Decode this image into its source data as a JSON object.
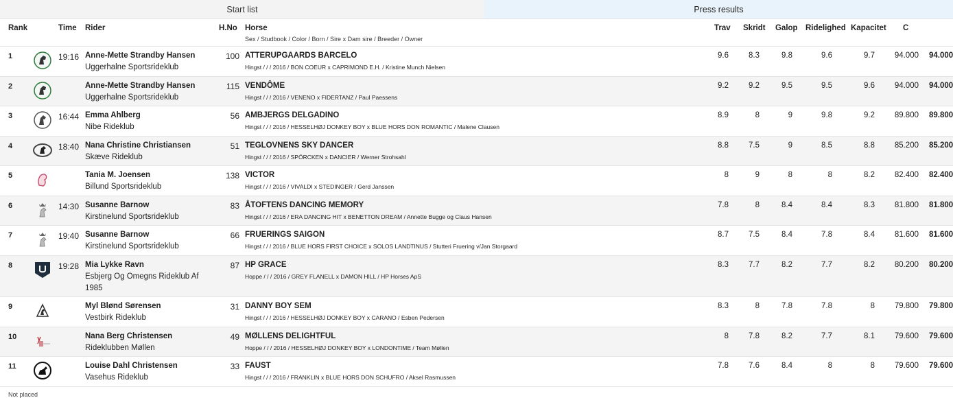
{
  "tabs": {
    "start_list": "Start list",
    "press_results": "Press results"
  },
  "headers": {
    "rank": "Rank",
    "time": "Time",
    "rider": "Rider",
    "hno": "H.No",
    "horse": "Horse",
    "horse_sub": "Sex / Studbook / Color / Born / Sire x Dam sire / Breeder / Owner",
    "trav": "Trav",
    "skridt": "Skridt",
    "galop": "Galop",
    "ridelighed": "Ridelighed",
    "kapacitet": "Kapacitet",
    "c": "C"
  },
  "rows": [
    {
      "rank": "1",
      "logo": "horse-head-logo",
      "time": "19:16",
      "rider": "Anne-Mette Strandby Hansen",
      "club": "Uggerhalne Sportsrideklub",
      "club2": "",
      "hno": "100",
      "horse": "ATTERUPGAARDS BARCELO",
      "info": "Hingst / / / 2016 / BON COEUR x CAPRIMOND E.H. / Kristine Munch Nielsen",
      "trav": "9.6",
      "skridt": "8.3",
      "galop": "9.8",
      "ridelighed": "9.6",
      "kapacitet": "9.7",
      "c": "94.000",
      "total": "94.000"
    },
    {
      "rank": "2",
      "logo": "horse-head-logo",
      "time": "",
      "rider": "Anne-Mette Strandby Hansen",
      "club": "Uggerhalne Sportsrideklub",
      "club2": "",
      "hno": "115",
      "horse": "VENDÔME",
      "info": "Hingst / / / 2016 / VENENO x FIDERTANZ / Paul Paessens",
      "trav": "9.2",
      "skridt": "9.2",
      "galop": "9.5",
      "ridelighed": "9.5",
      "kapacitet": "9.6",
      "c": "94.000",
      "total": "94.000"
    },
    {
      "rank": "3",
      "logo": "horse-circle-logo",
      "time": "16:44",
      "rider": "Emma Ahlberg",
      "club": "Nibe Rideklub",
      "club2": "",
      "hno": "56",
      "horse": "AMBJERGS DELGADINO",
      "info": "Hingst / / / 2016 / HESSELHØJ DONKEY BOY x BLUE HORS DON ROMANTIC / Malene Clausen",
      "trav": "8.9",
      "skridt": "8",
      "galop": "9",
      "ridelighed": "9.8",
      "kapacitet": "9.2",
      "c": "89.800",
      "total": "89.800"
    },
    {
      "rank": "4",
      "logo": "horse-wreath-logo",
      "time": "18:40",
      "rider": "Nana Christine Christiansen",
      "club": "Skæve Rideklub",
      "club2": "",
      "hno": "51",
      "horse": "TEGLOVNENS SKY DANCER",
      "info": "Hingst / / / 2016 / SPÖRCKEN x DANCIER / Werner Strohsahl",
      "trav": "8.8",
      "skridt": "7.5",
      "galop": "9",
      "ridelighed": "8.5",
      "kapacitet": "8.8",
      "c": "85.200",
      "total": "85.200"
    },
    {
      "rank": "5",
      "logo": "horse-pink-logo",
      "time": "",
      "rider": "Tania M. Joensen",
      "club": "Billund Sportsrideklub",
      "club2": "",
      "hno": "138",
      "horse": "VICTOR",
      "info": "Hingst / / / 2016 / VIVALDI x STEDINGER / Gerd Janssen",
      "trav": "8",
      "skridt": "9",
      "galop": "8",
      "ridelighed": "8",
      "kapacitet": "8.2",
      "c": "82.400",
      "total": "82.400"
    },
    {
      "rank": "6",
      "logo": "horse-crown-logo",
      "time": "14:30",
      "rider": "Susanne Barnow",
      "club": "Kirstinelund Sportsrideklub",
      "club2": "",
      "hno": "83",
      "horse": "ÅTOFTENS DANCING MEMORY",
      "info": "Hingst / / / 2016 / ERA DANCING HIT x BENETTON DREAM / Annette Bugge og Claus Hansen",
      "trav": "7.8",
      "skridt": "8",
      "galop": "8.4",
      "ridelighed": "8.4",
      "kapacitet": "8.3",
      "c": "81.800",
      "total": "81.800"
    },
    {
      "rank": "7",
      "logo": "horse-crown-logo",
      "time": "19:40",
      "rider": "Susanne Barnow",
      "club": "Kirstinelund Sportsrideklub",
      "club2": "",
      "hno": "66",
      "horse": "FRUERINGS SAIGON",
      "info": "Hingst / / / 2016 / BLUE HORS FIRST CHOICE x SOLOS LANDTINUS / Stutteri Fruering v/Jan Storgaard",
      "trav": "8.7",
      "skridt": "7.5",
      "galop": "8.4",
      "ridelighed": "7.8",
      "kapacitet": "8.4",
      "c": "81.600",
      "total": "81.600"
    },
    {
      "rank": "8",
      "logo": "shield-logo",
      "time": "19:28",
      "rider": "Mia Lykke Ravn",
      "club": "Esbjerg Og Omegns Rideklub Af",
      "club2": "1985",
      "hno": "87",
      "horse": "HP GRACE",
      "info": "Hoppe / / / 2016 / GREY FLANELL x DAMON HILL / HP Horses ApS",
      "trav": "8.3",
      "skridt": "7.7",
      "galop": "8.2",
      "ridelighed": "7.7",
      "kapacitet": "8.2",
      "c": "80.200",
      "total": "80.200"
    },
    {
      "rank": "9",
      "logo": "horse-emblem-logo",
      "time": "",
      "rider": "Myl Blønd Sørensen",
      "club": "Vestbirk Rideklub",
      "club2": "",
      "hno": "31",
      "horse": "DANNY BOY SEM",
      "info": "Hingst / / / 2016 / HESSELHØJ DONKEY BOY x CARANO / Esben Pedersen",
      "trav": "8.3",
      "skridt": "8",
      "galop": "7.8",
      "ridelighed": "7.8",
      "kapacitet": "8",
      "c": "79.800",
      "total": "79.800"
    },
    {
      "rank": "10",
      "logo": "mollen-logo",
      "time": "",
      "rider": "Nana Berg Christensen",
      "club": "Rideklubben Møllen",
      "club2": "",
      "hno": "49",
      "horse": "MØLLENS DELIGHTFUL",
      "info": "Hoppe / / / 2016 / HESSELHØJ DONKEY BOY x LONDONTIME / Team Møllen",
      "trav": "8",
      "skridt": "7.8",
      "galop": "8.2",
      "ridelighed": "7.7",
      "kapacitet": "8.1",
      "c": "79.600",
      "total": "79.600"
    },
    {
      "rank": "11",
      "logo": "rider-circle-logo",
      "time": "",
      "rider": "Louise Dahl Christensen",
      "club": "Vasehus Rideklub",
      "club2": "",
      "hno": "33",
      "horse": "FAUST",
      "info": "Hingst / / / 2016 / FRANKLIN x BLUE HORS DON SCHUFRO / Aksel Rasmussen",
      "trav": "7.8",
      "skridt": "7.6",
      "galop": "8.4",
      "ridelighed": "8",
      "kapacitet": "8",
      "c": "79.600",
      "total": "79.600"
    }
  ],
  "not_placed": "Not placed"
}
